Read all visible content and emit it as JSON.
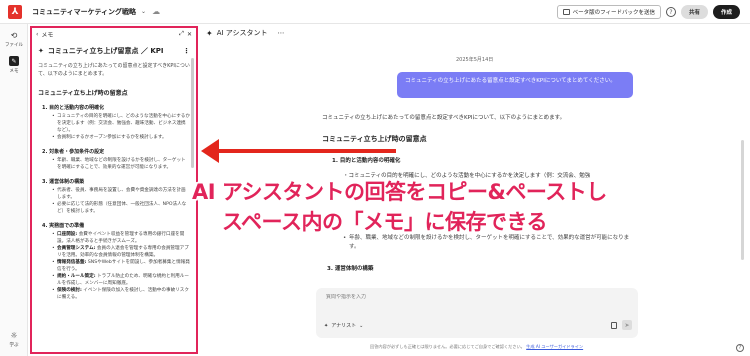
{
  "app": {
    "title": "コミュニティマーケティング戦略",
    "feedback_label": "ベータ版のフィードバックを送信",
    "share_label": "共有",
    "create_label": "作成",
    "help_icon": "?"
  },
  "rail": {
    "items": [
      {
        "label": "ファイル",
        "icon": "file-icon"
      },
      {
        "label": "メモ",
        "icon": "memo-icon"
      },
      {
        "label": "学ぶ",
        "icon": "lightbulb-icon"
      }
    ]
  },
  "memo": {
    "header_label": "メモ",
    "title": "コミュニティ立ち上げ留意点 ／ KPI",
    "intro": "コミュニティの立ち上げにあたっての留意点と設定すべきKPIについて、以下のようにまとめます。",
    "heading": "コミュニティ立ち上げ時の留意点",
    "sections": [
      {
        "title": "1. 目的と活動内容の明確化",
        "bullets": [
          "コミュニティの目的を明確にし、どのような活動を中心にするかを決定します（例：交流会、勉強会、趣味活動、ビジネス連携など）。",
          "会員制にするかオープン参加にするかを検討します。"
        ]
      },
      {
        "title": "2. 対象者・参加条件の設定",
        "bullets": [
          "年齢、職業、地域などの制限を設けるかを検討し、ターゲットを明確にすることで、効果的な運営が可能になります。"
        ]
      },
      {
        "title": "3. 運営体制の構築",
        "bullets": [
          "代表者、役員、事務局を設置し、会費や資金調達の方法を計画します。",
          "必要に応じて法的形態（任意団体、一般社団法人、NPO法人など）を検討します。"
        ]
      }
    ],
    "section4": {
      "title": "4. 実務面での準備",
      "items": [
        {
          "label": "口座開設:",
          "text": "会費やイベント収益を管理する専用の銀行口座を開設。法人格があると手続きがスムーズ。"
        },
        {
          "label": "会員管理システム:",
          "text": "会員の入退会を管理する専用の会員管理アプリを活用。効率的な会員情報の管理体制を構築。"
        },
        {
          "label": "情報発信基盤:",
          "text": "SNSやWebサイトを開設し、参加者募集と情報発信を行う。"
        },
        {
          "label": "規約・ルール策定:",
          "text": "トラブル防止のため、明確な規約と利用ルールを作成し、メンバーに周知徹底。"
        },
        {
          "label": "保険の検討:",
          "text": "イベント保険の加入を検討し、活動中の事故リスクに備える。"
        }
      ]
    }
  },
  "chat": {
    "header_title": "AI アシスタント",
    "date": "2025年5月14日",
    "user_message": "コミュニティの立ち上げにあたる留意点と設定すべきKPIについてまとめてください。",
    "ai_intro": "コミュニティの立ち上げにあたっての留意点と設定すべきKPIについて、以下のようにまとめます。",
    "ai_heading": "コミュニティ立ち上げ時の留意点",
    "ai_sub1": "1. 目的と活動内容の明確化",
    "ai_bullet_partial": "・コミュニティの目的を明確にし、どのような活動を中心にするかを決定します（例：交流会、勉強",
    "ai_bullet_year": "年齢、職業、地域などの制限を設けるかを検討し、ターゲットを明確にすることで、効果的な運営が可能になります。",
    "ai_sub3": "3. 運営体制の構築",
    "composer_placeholder": "質問や指示を入力",
    "mode_label": "アナリスト",
    "disclaimer": "回答内容が必ずしも正確とは限りません。必要に応じてご自身でご確認ください。",
    "disclaimer_link": "生成 AI ユーザーガイドライン"
  },
  "annotation": {
    "line1": "AI アシスタントの回答をコピー&ペーストし",
    "line2": "スペース内の「メモ」に保存できる",
    "color": "#e1245a",
    "arrow_color": "#e3261c"
  }
}
